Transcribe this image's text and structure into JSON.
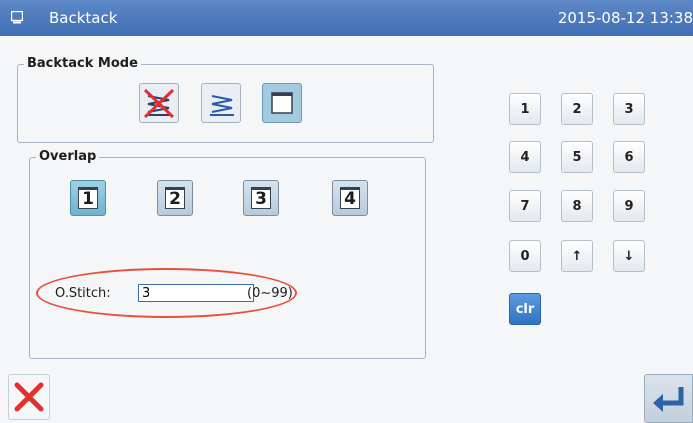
{
  "header": {
    "title": "Backtack",
    "datetime": "2015-08-12 13:38",
    "icon": "display-icon"
  },
  "backtack_mode": {
    "label": "Backtack Mode",
    "options": [
      {
        "icon": "backtack-disabled-icon",
        "selected": false
      },
      {
        "icon": "backtack-zigzag-icon",
        "selected": false
      },
      {
        "icon": "backtack-blank-icon",
        "selected": true
      }
    ]
  },
  "overlap": {
    "label": "Overlap",
    "options": [
      {
        "label": "1",
        "selected": true
      },
      {
        "label": "2",
        "selected": false
      },
      {
        "label": "3",
        "selected": false
      },
      {
        "label": "4",
        "selected": false
      }
    ],
    "stitch_label": "O.Stitch:",
    "stitch_value": "3",
    "stitch_range": "(0~99)"
  },
  "keypad": {
    "keys": [
      "1",
      "2",
      "3",
      "4",
      "5",
      "6",
      "7",
      "8",
      "9",
      "0",
      "↑",
      "↓"
    ],
    "clear_label": "clr"
  },
  "footer": {
    "cancel_icon": "close-icon",
    "confirm_icon": "enter-icon"
  },
  "colors": {
    "titlebar": "#4a7abd",
    "selected": "#a3cbe0",
    "clear_key": "#3a82d0",
    "highlight": "#e8503a",
    "cancel": "#e0312c"
  }
}
